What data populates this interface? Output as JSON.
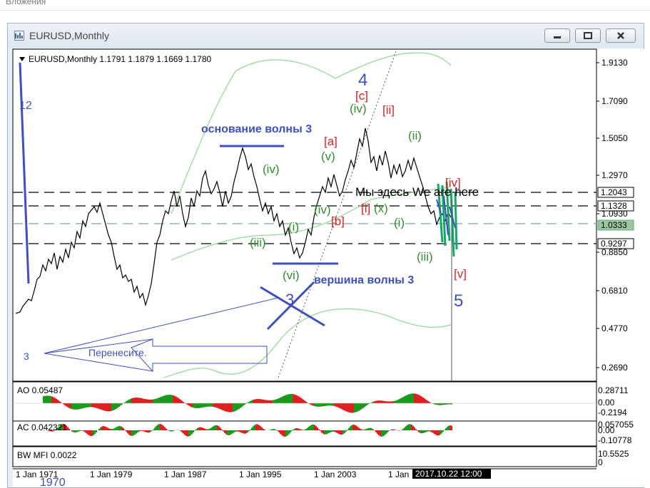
{
  "top_label": "Вложения",
  "window": {
    "title": "EURUSD,Monthly"
  },
  "chart": {
    "info": "EURUSD,Monthly  1.1791 1.1879 1.1669 1.1780",
    "price_ticks": [
      "1.9130",
      "1.7090",
      "1.5050",
      "1.2970",
      "1.0930",
      "0.8850",
      "0.6810",
      "0.4770",
      "0.2690"
    ],
    "price_boxes": [
      "1.2043",
      "1.1328",
      "1.0333",
      "0.9297"
    ],
    "time_ticks": [
      "1 Jan 1971",
      "1 Jan 1979",
      "1 Jan 1987",
      "1 Jan 1995",
      "1 Jan 2003",
      "1 Jan"
    ],
    "time_cursor": "2017.10.22 12:00",
    "subpanels": {
      "ao_label": "AO 0.05487",
      "ao_ticks": [
        "0.28711",
        "0.00",
        "-0.2194"
      ],
      "ac_label": "AC 0.042321",
      "ac_ticks": [
        "0.057055",
        "0.00",
        "-0.10778"
      ],
      "mfi_label": "BW MFI 0.0022",
      "mfi_ticks": [
        "10.5525",
        "0"
      ]
    }
  },
  "annotations": {
    "base_wave3": "основание волны 3",
    "top_wave3": "вершина волны 3",
    "we_are_here": "Мы здесь We are here",
    "move_text": "Перенесите.",
    "num_12": "12",
    "num_3_left": "3",
    "num_3_cross": "3",
    "num_4": "4",
    "num_5": "5",
    "year_1970": "1970",
    "wave_iv": "(iv)",
    "wave_iii": "(iii)",
    "wave_i": "(i)",
    "wave_vi": "(vi)",
    "wave_a": "[a]",
    "wave_c": "[c]",
    "wave_ii_red": "[ii]",
    "wave_ii_green": "(ii)",
    "wave_v": "(v)",
    "wave_x": "(x)",
    "wave_iv_big": "(iv)",
    "wave_b": "[b]",
    "wave_i_red": "[i]",
    "wave_v_red": "[v]",
    "wave_iv_red": "[iv]"
  },
  "colors": {
    "blue_annot": "#3e4fc4",
    "green_annot": "#2f8f2a",
    "red_annot": "#e02020",
    "envelope": "#9ad69a",
    "price": "#000000"
  }
}
